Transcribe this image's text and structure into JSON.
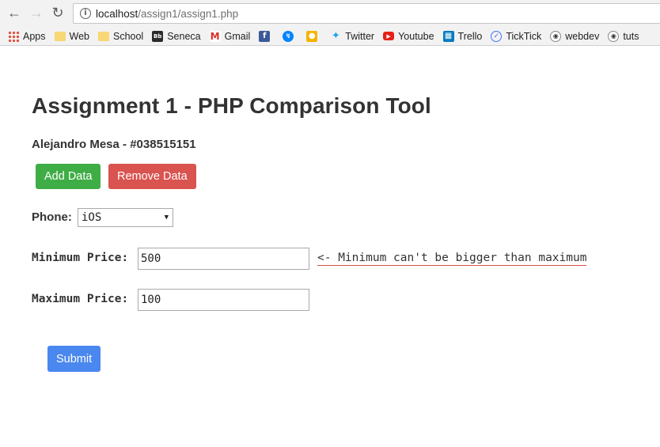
{
  "browser": {
    "url_host": "localhost",
    "url_path": "/assign1/assign1.php",
    "bookmarks": [
      {
        "label": "Apps",
        "icon": "apps-grid-icon"
      },
      {
        "label": "Web",
        "icon": "folder-icon"
      },
      {
        "label": "School",
        "icon": "folder-icon"
      },
      {
        "label": "Seneca",
        "icon": "blackboard-icon"
      },
      {
        "label": "Gmail",
        "icon": "gmail-icon"
      },
      {
        "label": "",
        "icon": "facebook-icon"
      },
      {
        "label": "",
        "icon": "messenger-icon"
      },
      {
        "label": "",
        "icon": "keep-icon"
      },
      {
        "label": "Twitter",
        "icon": "twitter-icon"
      },
      {
        "label": "Youtube",
        "icon": "youtube-icon"
      },
      {
        "label": "Trello",
        "icon": "trello-icon"
      },
      {
        "label": "TickTick",
        "icon": "ticktick-icon"
      },
      {
        "label": "webdev",
        "icon": "reddit-icon"
      },
      {
        "label": "tuts",
        "icon": "reddit-icon"
      }
    ]
  },
  "page": {
    "title": "Assignment 1 - PHP Comparison Tool",
    "author": "Alejandro Mesa - #038515151",
    "add_button": "Add Data",
    "remove_button": "Remove Data",
    "phone_label": "Phone:",
    "phone_selected": "iOS",
    "min_label": "Minimum Price:",
    "min_value": "500",
    "error_text": "<- Minimum can't be bigger than maximum",
    "max_label": "Maximum Price:",
    "max_value": "100",
    "submit_button": "Submit"
  },
  "colors": {
    "add": "#3fad46",
    "remove": "#d9534f",
    "submit": "#4a87ee",
    "error_underline": "#d9534f"
  }
}
